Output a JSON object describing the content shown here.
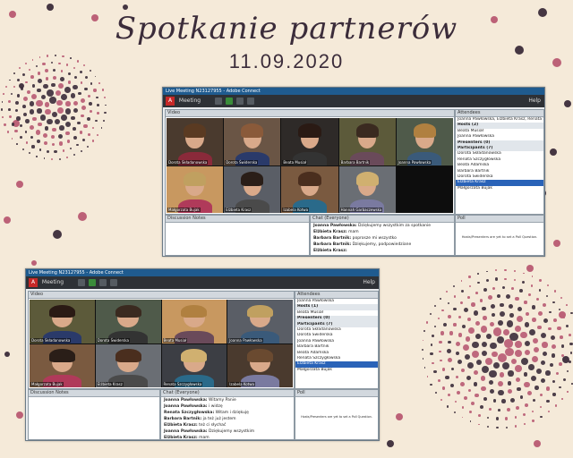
{
  "title": "Spotkanie partnerów",
  "date": "11.09.2020",
  "colors": {
    "background": "#f5ead9",
    "dot_dark": "#3b2c3a",
    "dot_rose": "#b85a72",
    "titlebar": "#1f5b8f",
    "appbar": "#2e3136"
  },
  "screens": [
    {
      "window_title": "Live Meeting N23127955 - Adobe Connect",
      "meeting_menu": "Meeting",
      "help": "Help",
      "video_label": "Video",
      "attendees_label": "Attendees",
      "notes_label": "Discussion Notes",
      "chat_label": "Chat",
      "chat_scope": "(Everyone)",
      "poll_label": "Poll",
      "poll_message": "Hosts/Presenters are yet to set a Poll Question.",
      "tiles": [
        "Dorota Składanowska",
        "Dorota Świderska",
        "Beata Musiał",
        "Barbara Bartnik",
        "Joanna Pawłowska",
        "Małgorzata Bujak",
        "Elżbieta Krasz",
        "Izabela Kotwa",
        "Hannah Garbaczewska",
        ""
      ],
      "attendees": [
        {
          "label": "Joanna Pawłowska, Elżbieta Krasz, Renata Szczygłowska",
          "type": "row"
        },
        {
          "label": "Hosts (2)",
          "type": "sec"
        },
        {
          "label": "Beata Musiał",
          "type": "row"
        },
        {
          "label": "Joanna Pawłowska",
          "type": "row"
        },
        {
          "label": "Presenters (0)",
          "type": "sec"
        },
        {
          "label": "Participants (7)",
          "type": "sec"
        },
        {
          "label": "Dorota Składanowska",
          "type": "row"
        },
        {
          "label": "Renata Szczygłowska",
          "type": "row"
        },
        {
          "label": "Beata Adamska",
          "type": "row"
        },
        {
          "label": "Barbara Bartnik",
          "type": "row"
        },
        {
          "label": "Dorota Świderska",
          "type": "row"
        },
        {
          "label": "Elżbieta Krasz",
          "type": "hl"
        },
        {
          "label": "Małgorzata Bujak",
          "type": "row"
        }
      ],
      "chat": [
        {
          "who": "Joanna Pawłowska:",
          "msg": "Dziękujemy wszystkim za spotkanie"
        },
        {
          "who": "Elżbieta Krasz:",
          "msg": "mam"
        },
        {
          "who": "Barbara Bartnik:",
          "msg": "poprosze mi wszystko"
        },
        {
          "who": "Barbara Bartnik:",
          "msg": "Dziękujemy, podpowiedziane"
        },
        {
          "who": "Elżbieta Krasz:",
          "msg": ""
        }
      ]
    },
    {
      "window_title": "Live Meeting N23127955 - Adobe Connect",
      "meeting_menu": "Meeting",
      "help": "Help",
      "video_label": "Video",
      "attendees_label": "Attendees",
      "notes_label": "Discussion Notes",
      "chat_label": "Chat",
      "chat_scope": "(Everyone)",
      "poll_label": "Poll",
      "poll_message": "Hosts/Presenters are yet to set a Poll Question.",
      "tiles": [
        "Dorota Składanowska",
        "Dorota Świderska",
        "Beata Musiał",
        "Joanna Pawłowska",
        "Małgorzata Bujak",
        "Elżbieta Krasz",
        "Renata Szczygłowska",
        "Izabela Kotwa"
      ],
      "attendees": [
        {
          "label": "Joanna Pawłowska",
          "type": "row"
        },
        {
          "label": "Hosts (1)",
          "type": "sec"
        },
        {
          "label": "Beata Musiał",
          "type": "row"
        },
        {
          "label": "Presenters (0)",
          "type": "sec"
        },
        {
          "label": "Participants (7)",
          "type": "sec"
        },
        {
          "label": "Dorota Składanowska",
          "type": "row"
        },
        {
          "label": "Dorota Świderska",
          "type": "row"
        },
        {
          "label": "Joanna Pawłowska",
          "type": "row"
        },
        {
          "label": "Barbara Bartnik",
          "type": "row"
        },
        {
          "label": "Beata Adamska",
          "type": "row"
        },
        {
          "label": "Renata Szczygłowska",
          "type": "row"
        },
        {
          "label": "Elżbieta Krasz",
          "type": "hl"
        },
        {
          "label": "Małgorzata Bujak",
          "type": "row"
        }
      ],
      "chat": [
        {
          "who": "Joanna Pawłowska:",
          "msg": "Witamy Panie"
        },
        {
          "who": "Joanna Pawłowska:",
          "msg": "i widzę"
        },
        {
          "who": "Renata Szczygłowska:",
          "msg": "Witam i dziękuję"
        },
        {
          "who": "Barbara Bartnik:",
          "msg": "ja też już jestem"
        },
        {
          "who": "Elżbieta Krasz:",
          "msg": "też ci słychać"
        },
        {
          "who": "Joanna Pawłowska:",
          "msg": "Dziękujemy wszystkim"
        },
        {
          "who": "Elżbieta Krasz:",
          "msg": "mam"
        }
      ]
    }
  ]
}
